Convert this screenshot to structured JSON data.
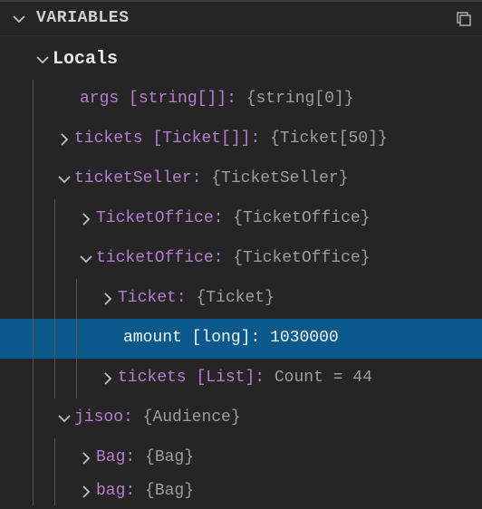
{
  "panel": {
    "title": "VARIABLES"
  },
  "scope": {
    "name": "Locals"
  },
  "rows": [
    {
      "depth": 1,
      "expand": "none",
      "name": "args",
      "type": "[string[]]",
      "value": "{string[0]}",
      "selected": false
    },
    {
      "depth": 1,
      "expand": "closed",
      "name": "tickets",
      "type": "[Ticket[]]",
      "value": "{Ticket[50]}",
      "selected": false
    },
    {
      "depth": 1,
      "expand": "open",
      "name": "ticketSeller",
      "type": "",
      "value": "{TicketSeller}",
      "selected": false
    },
    {
      "depth": 2,
      "expand": "closed",
      "name": "TicketOffice",
      "type": "",
      "value": "{TicketOffice}",
      "selected": false
    },
    {
      "depth": 2,
      "expand": "open",
      "name": "ticketOffice",
      "type": "",
      "value": "{TicketOffice}",
      "selected": false
    },
    {
      "depth": 3,
      "expand": "closed",
      "name": "Ticket",
      "type": "",
      "value": "{Ticket}",
      "selected": false
    },
    {
      "depth": 3,
      "expand": "none",
      "name": "amount",
      "type": "[long]",
      "value": "1030000",
      "selected": true
    },
    {
      "depth": 3,
      "expand": "closed",
      "name": "tickets",
      "type": "[List]",
      "value": "Count = 44",
      "selected": false
    },
    {
      "depth": 1,
      "expand": "open",
      "name": "jisoo",
      "type": "",
      "value": "{Audience}",
      "selected": false
    },
    {
      "depth": 2,
      "expand": "closed",
      "name": "Bag",
      "type": "",
      "value": "{Bag}",
      "selected": false
    },
    {
      "depth": 2,
      "expand": "closed",
      "name": "bag",
      "type": "",
      "value": "{Bag}",
      "selected": false
    }
  ]
}
